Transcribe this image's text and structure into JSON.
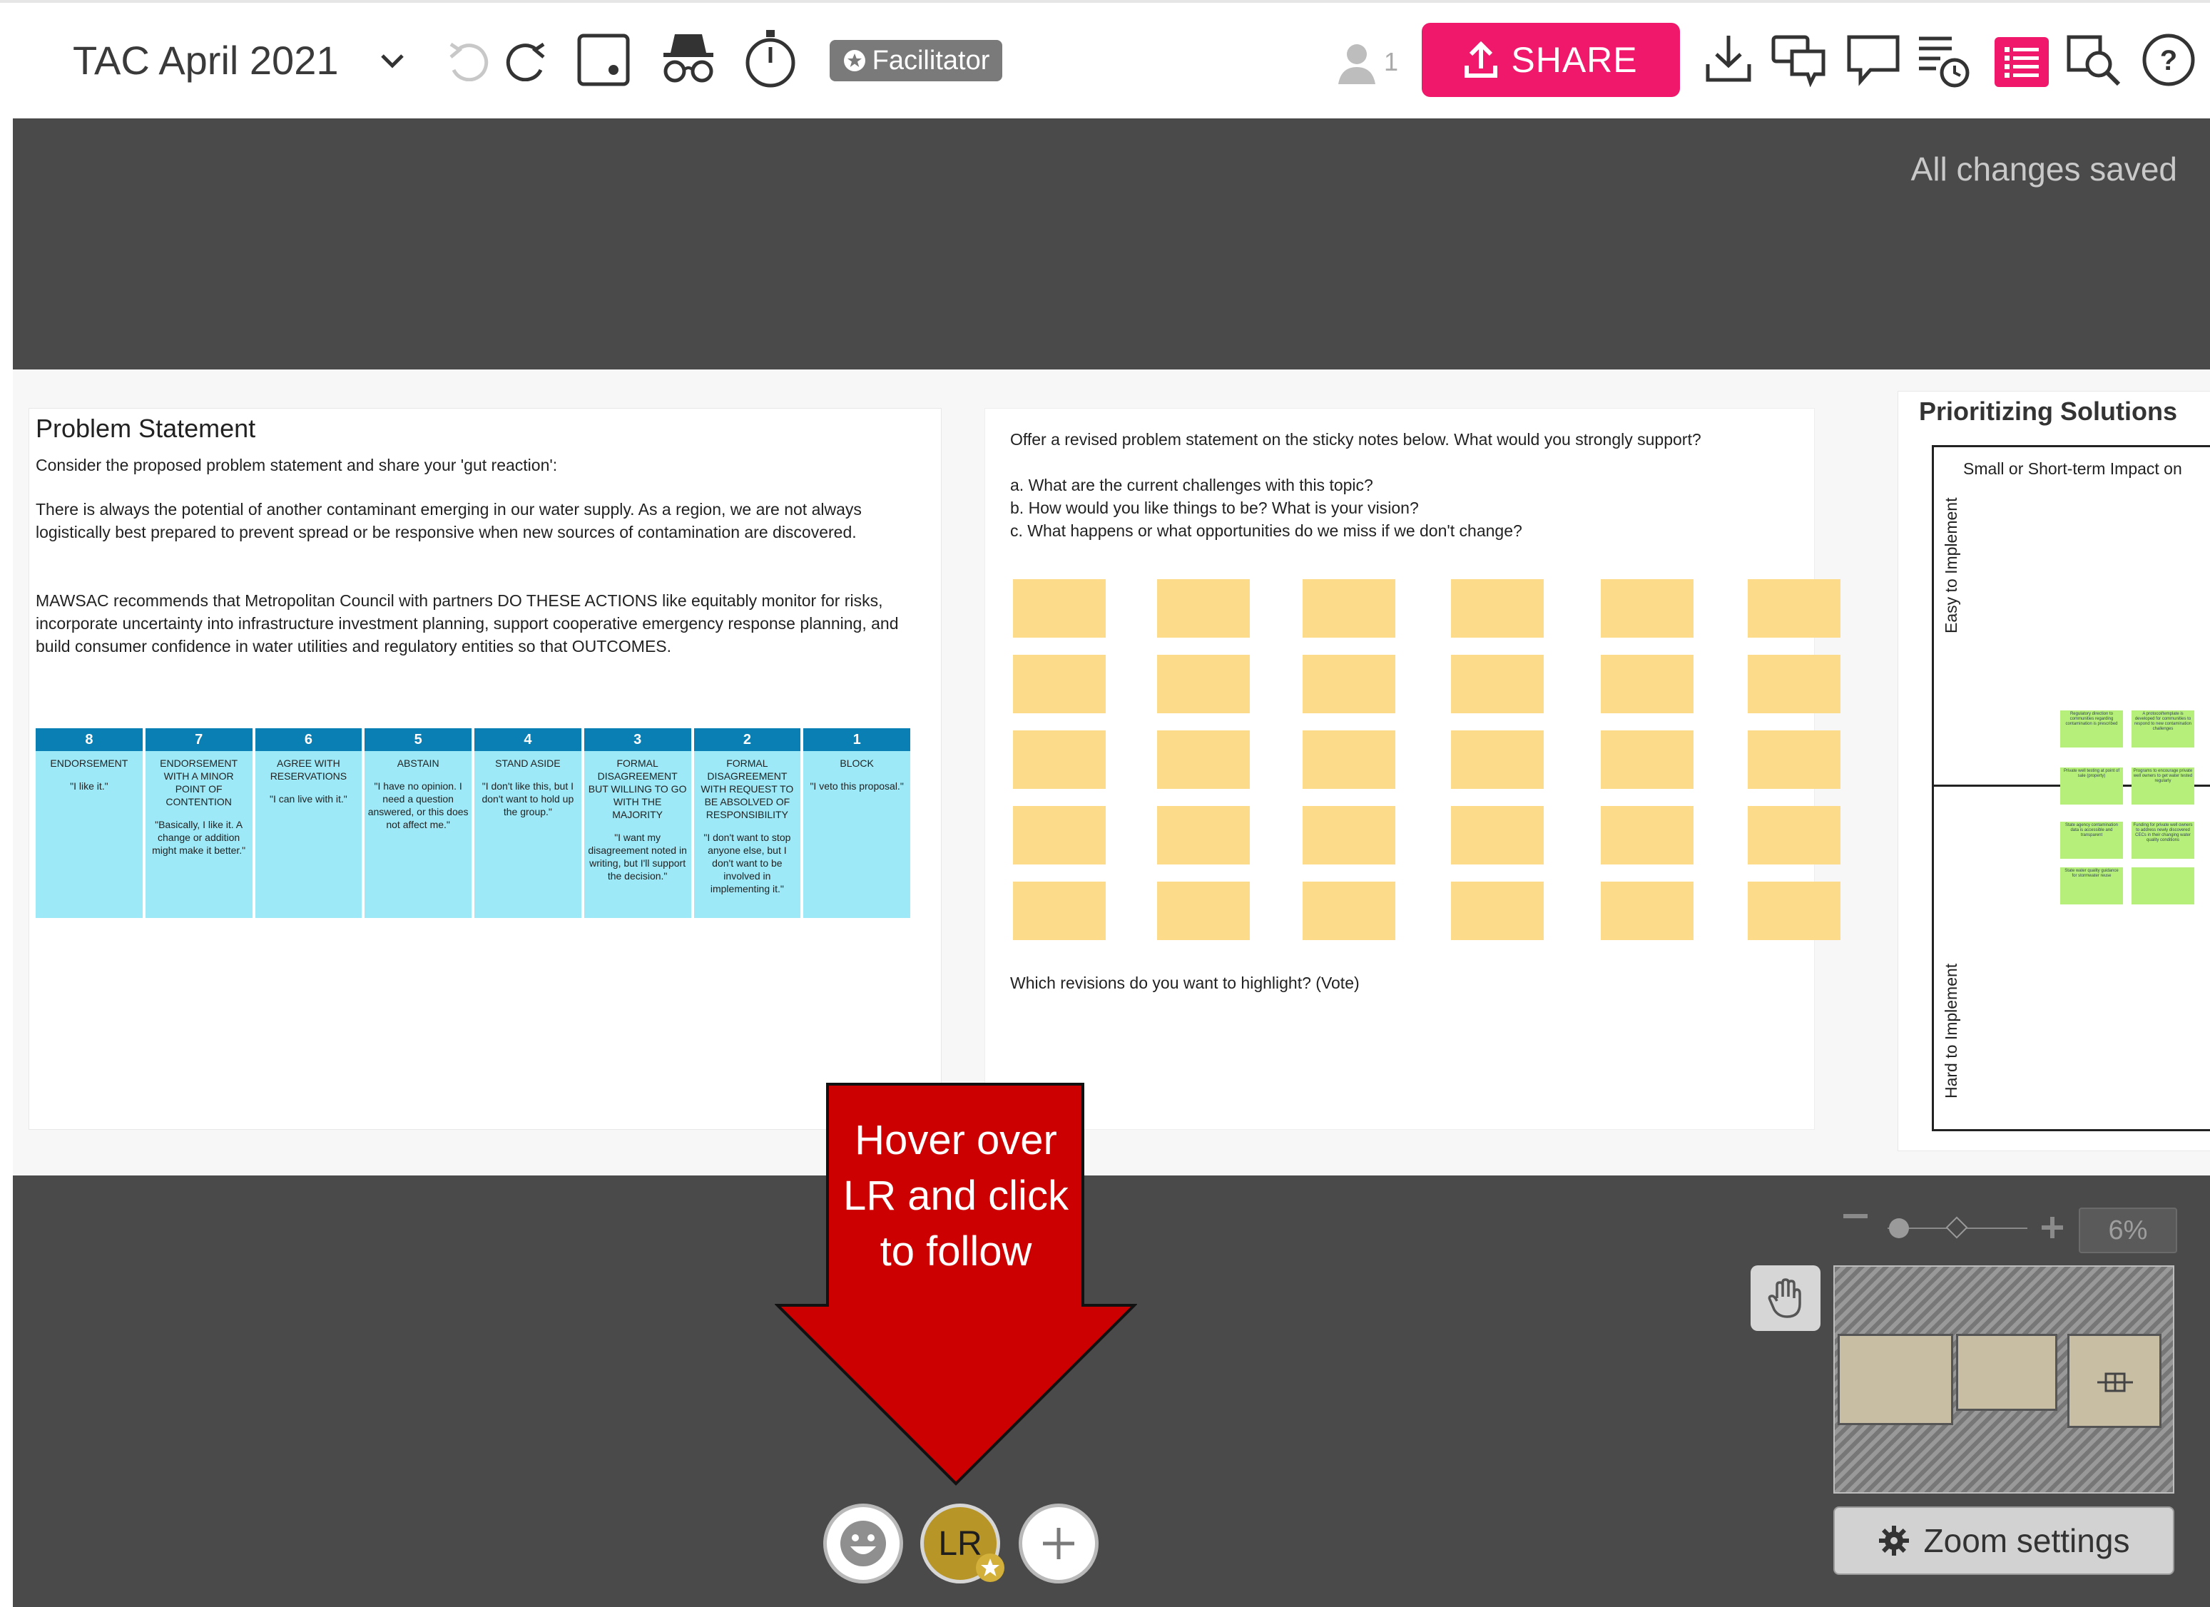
{
  "toolbar": {
    "board_title": "TAC April 2021",
    "facilitator_label": "Facilitator",
    "online_users_count": "1",
    "share_label": "SHARE",
    "accent_color": "#f0186a",
    "icons": [
      "chevron-down-icon",
      "undo-icon",
      "redo-icon",
      "presentation-mode-icon",
      "private-mode-icon",
      "timer-icon",
      "user-icon",
      "upload-icon",
      "download-icon",
      "chat-icon",
      "comment-icon",
      "activity-icon",
      "outline-list-icon",
      "search-icon",
      "help-icon"
    ]
  },
  "status": {
    "save_status": "All changes saved"
  },
  "problem_frame": {
    "title": "Problem Statement",
    "intro": "Consider the proposed problem statement and share your 'gut reaction':",
    "paragraph1": "There is always the potential of another contaminant emerging in our water supply. As a region, we are not always logistically best prepared to prevent spread or be responsive when new sources of contamination are discovered.",
    "paragraph2": "MAWSAC recommends that Metropolitan Council with partners DO THESE ACTIONS like equitably monitor for risks, incorporate uncertainty into infrastructure investment planning, support cooperative emergency response planning, and build consumer confidence in water utilities and regulatory entities so that OUTCOMES.",
    "scale": [
      {
        "number": "8",
        "label": "Endorsement",
        "quote": "\"I like it.\""
      },
      {
        "number": "7",
        "label": "Endorsement with a minor point of contention",
        "quote": "\"Basically, I like it. A change or addition might make it better.\""
      },
      {
        "number": "6",
        "label": "Agree with reservations",
        "quote": "\"I can live with it.\""
      },
      {
        "number": "5",
        "label": "Abstain",
        "quote": "\"I have no opinion. I need a question answered, or this does not affect me.\""
      },
      {
        "number": "4",
        "label": "Stand aside",
        "quote": "\"I don't like this, but I don't want to hold up the group.\""
      },
      {
        "number": "3",
        "label": "Formal disagreement but willing to go with the majority",
        "quote": "\"I want my disagreement noted in writing, but I'll support the decision.\""
      },
      {
        "number": "2",
        "label": "Formal disagreement with request to be absolved of responsibility",
        "quote": "\"I don't want to stop anyone else, but I don't want to be involved in implementing it.\""
      },
      {
        "number": "1",
        "label": "Block",
        "quote": "\"I veto this proposal.\""
      }
    ]
  },
  "revision_frame": {
    "prompt": "Offer a revised problem statement on the sticky notes below. What would you strongly support?",
    "question_a": "a. What are the current challenges with this topic?",
    "question_b": "b. How would you like things to be? What is your vision?",
    "question_c": "c. What happens or what opportunities do we miss if we don't change?",
    "vote_prompt": "Which revisions do you want to highlight? (Vote)",
    "sticky_color": "#fcdc8a",
    "sticky_rows": 5,
    "sticky_cols": 6
  },
  "prioritize_frame": {
    "title": "Prioritizing Solutions",
    "matrix_top_label": "Small or Short-term Impact on",
    "axis_easy": "Easy to Implement",
    "axis_hard": "Hard to Implement",
    "mini_stickies": [
      "Regulatory direction to communities regarding contamination is prescribed",
      "A protocol/template is developed for communities to respond to new contamination challenges",
      "Private well testing at point of sale (property)",
      "Programs to encourage private well owners to get water tested regularly",
      "State agency contamination data is accessible and transparent",
      "Funding for private well owners to address newly discovered CECs in their changing water quality conditions",
      "State water quality guidance for stormwater reuse",
      ""
    ],
    "sticky_color": "#b6f07a"
  },
  "callout": {
    "text": "Hover over LR and click to follow",
    "color": "#cc0000"
  },
  "participants": {
    "avatar_initials": "LR",
    "avatar_color": "#b89527"
  },
  "zoom": {
    "level": "6%",
    "settings_label": "Zoom settings"
  }
}
